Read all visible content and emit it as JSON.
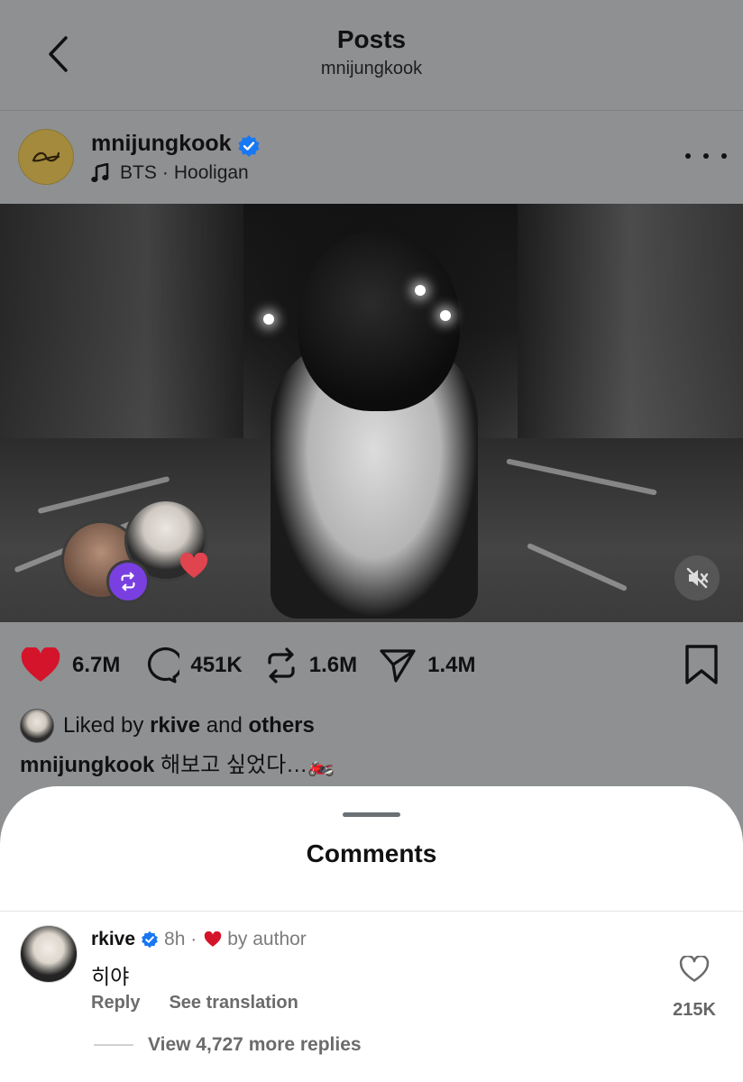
{
  "header": {
    "title": "Posts",
    "subtitle": "mnijungkook"
  },
  "post": {
    "username": "mnijungkook",
    "music_artist": "BTS",
    "music_separator": "·",
    "music_track": "Hooligan",
    "likes": "6.7M",
    "comments": "451K",
    "reposts": "1.6M",
    "shares": "1.4M",
    "liked_by_prefix": "Liked by",
    "liked_by_user": "rkive",
    "liked_by_and": "and",
    "liked_by_others": "others",
    "caption_user": "mnijungkook",
    "caption_text": "해보고 싶었다…🏍️"
  },
  "comments_sheet": {
    "title": "Comments",
    "comment": {
      "username": "rkive",
      "time": "8h ·",
      "liked_by_author": "by author",
      "text": "히야",
      "reply_label": "Reply",
      "translate_label": "See translation",
      "like_count": "215K",
      "more_replies": "View 4,727 more replies"
    }
  },
  "colors": {
    "like_red": "#d4142b",
    "verified_blue": "#1877f2",
    "repost_purple": "#7a3fe0"
  }
}
